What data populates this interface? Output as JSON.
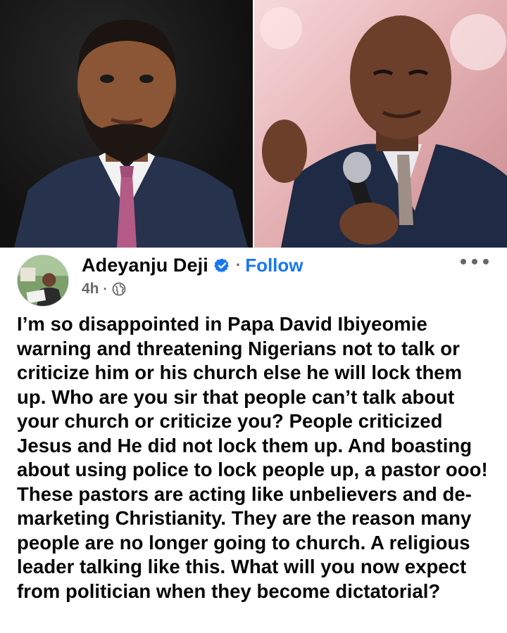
{
  "post": {
    "author": "Adeyanju Deji",
    "separator": "·",
    "follow_label": "Follow",
    "time": "4h",
    "time_separator": "·",
    "body": "I’m so disappointed in Papa David Ibiyeomie warning and threatening Nigerians not to talk or criticize him or his church else he will lock them up. Who are you sir that people can’t talk about your church or criticize you? People criticized Jesus and He did not lock them up. And boasting about using police to lock people up, a pastor ooo! These pastors are acting like unbelievers and de-marketing Christianity. They are the reason many people are no longer going to church. A religious leader talking like this. What will you now expect from politician when they become dictatorial?"
  },
  "icons": {
    "verified": "verified-badge-icon",
    "audience": "globe-icon",
    "more": "more-options-icon"
  },
  "colors": {
    "accent": "#1877f2",
    "text": "#050505",
    "secondary": "#65676b"
  }
}
